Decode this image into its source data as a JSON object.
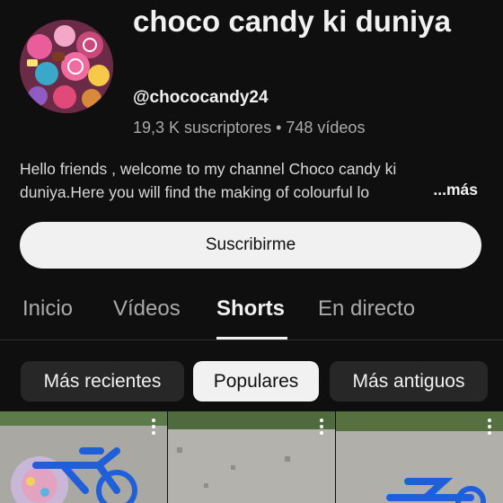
{
  "channel": {
    "name": "choco candy ki duniya",
    "handle": "@chococandy24",
    "stats": "19,3 K suscriptores • 748 vídeos",
    "description_line1": "Hello friends , welcome  to my channel  Choco candy ki",
    "description_line2": "duniya.Here you will find the making of colourful lo",
    "more_label": "...más",
    "subscribe_label": "Suscribirme"
  },
  "tabs": [
    {
      "label": "Inicio"
    },
    {
      "label": "Vídeos"
    },
    {
      "label": "Shorts",
      "active": true
    },
    {
      "label": "En directo"
    }
  ],
  "filters": [
    {
      "label": "Más recientes"
    },
    {
      "label": "Populares",
      "selected": true
    },
    {
      "label": "Más antiguos"
    }
  ],
  "colors": {
    "background": "#0f0f0f",
    "text_primary": "#f1f1f1",
    "text_secondary": "#aaaaaa",
    "chip_bg": "#272727"
  }
}
